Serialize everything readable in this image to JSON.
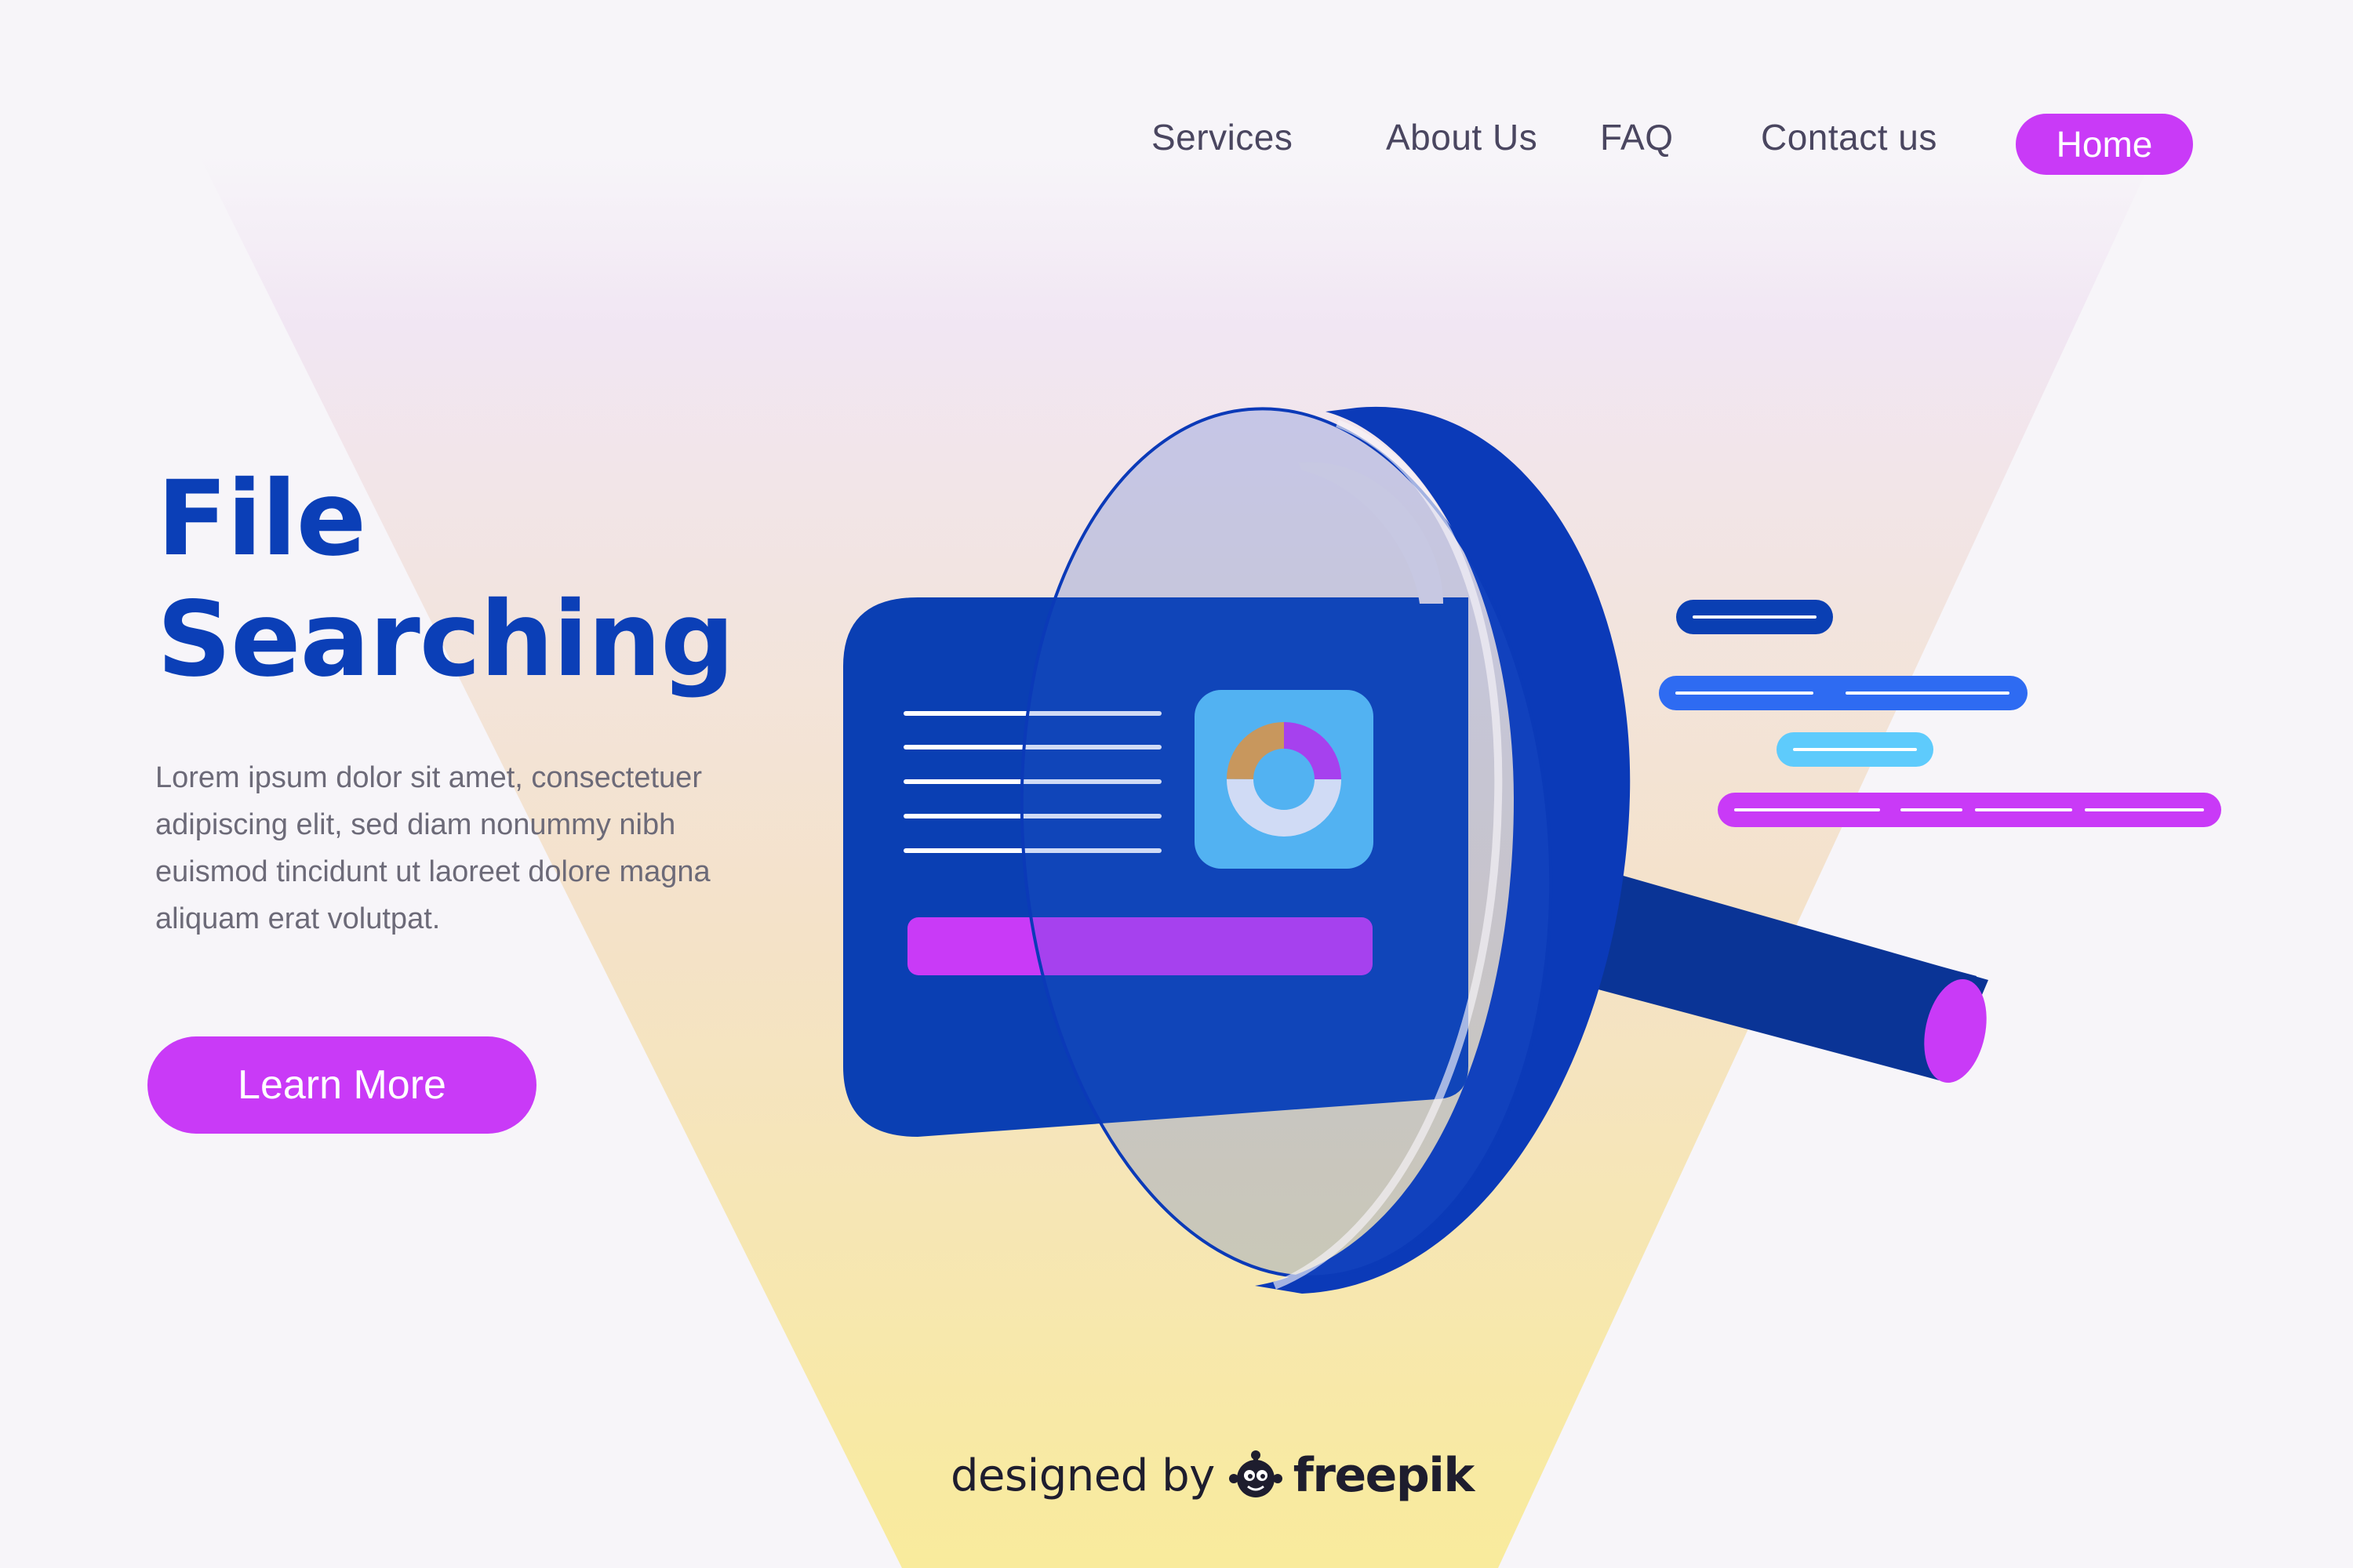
{
  "nav": {
    "items": [
      {
        "label": "Services"
      },
      {
        "label": "About Us"
      },
      {
        "label": "FAQ"
      },
      {
        "label": "Contact us"
      }
    ],
    "home_label": "Home"
  },
  "hero": {
    "title_line1": "File",
    "title_line2": "Searching",
    "description": "Lorem ipsum dolor sit amet, consectetuer adipiscing elit, sed diam nonummy nibh euismod tincidunt ut laoreet dolore magna aliquam erat volutpat.",
    "cta_label": "Learn More"
  },
  "credit": {
    "prefix": "designed by",
    "brand": "freepik"
  },
  "colors": {
    "accent": "#c93af7",
    "primary_blue": "#0b3fb7",
    "card_blue": "#0a3fb3",
    "light_blue": "#5ecbfc",
    "orange": "#f5a83d",
    "background": "#f7f5f9",
    "spotlight_top": "#f1e6f3",
    "spotlight_bottom": "#f9eb9c"
  },
  "illustration": {
    "donut_segments": [
      {
        "color": "#c93af7",
        "fraction": 0.25
      },
      {
        "color": "#ffffff",
        "fraction": 0.5
      },
      {
        "color": "#f5a83d",
        "fraction": 0.25
      }
    ]
  }
}
